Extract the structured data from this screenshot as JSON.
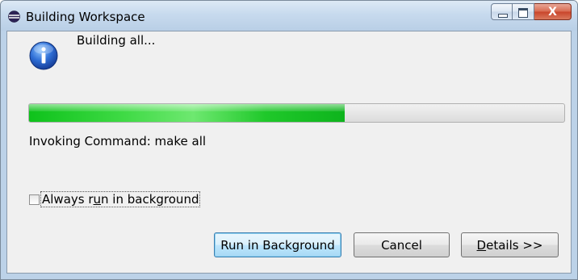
{
  "window": {
    "title": "Building Workspace",
    "close_glyph": "X"
  },
  "message": "Building all...",
  "progress": {
    "fraction": 0.59
  },
  "status_text": "Invoking Command: make all",
  "checkbox": {
    "label": "Always run in background",
    "checked": false
  },
  "buttons": {
    "run_in_background": "Run in Background",
    "cancel": "Cancel",
    "details": "Details >>"
  },
  "icons": {
    "app": "eclipse-icon",
    "info": "info-icon"
  },
  "colors": {
    "progress_fill": "#1fc82a",
    "default_button_border": "#3c7fb1"
  }
}
